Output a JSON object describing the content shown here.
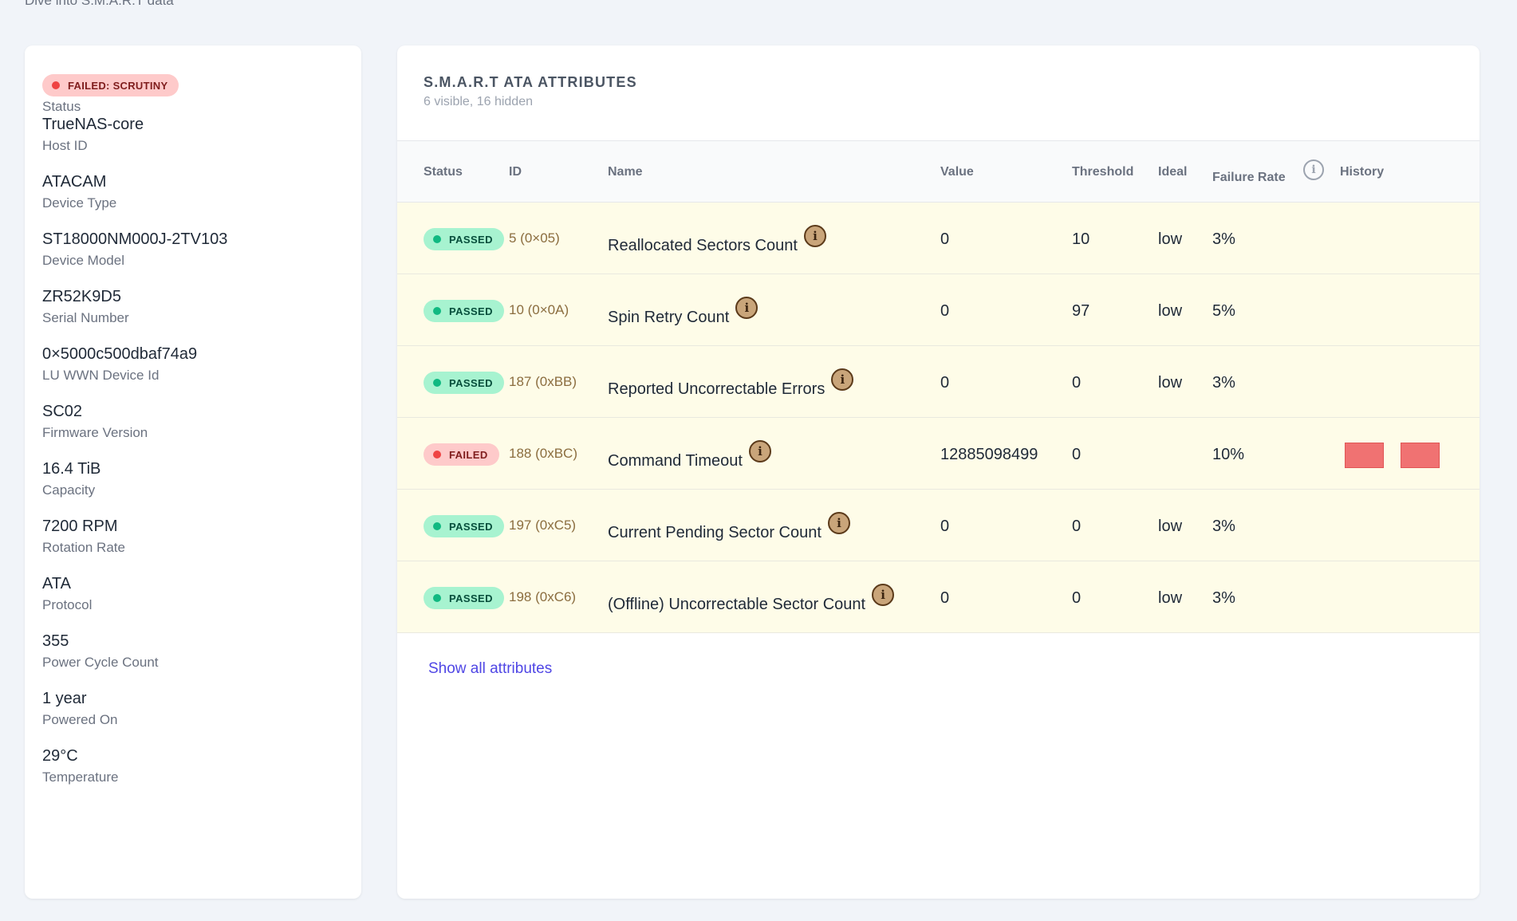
{
  "page": {
    "subtitle": "Dive into S.M.A.R.T data"
  },
  "device": {
    "status_badge": "FAILED: SCRUTINY",
    "status_label": "Status",
    "fields": [
      {
        "value": "TrueNAS-core",
        "label": "Host ID"
      },
      {
        "value": "ATACAM",
        "label": "Device Type"
      },
      {
        "value": "ST18000NM000J-2TV103",
        "label": "Device Model"
      },
      {
        "value": "ZR52K9D5",
        "label": "Serial Number"
      },
      {
        "value": "0×5000c500dbaf74a9",
        "label": "LU WWN Device Id"
      },
      {
        "value": "SC02",
        "label": "Firmware Version"
      },
      {
        "value": "16.4 TiB",
        "label": "Capacity"
      },
      {
        "value": "7200 RPM",
        "label": "Rotation Rate"
      },
      {
        "value": "ATA",
        "label": "Protocol"
      },
      {
        "value": "355",
        "label": "Power Cycle Count"
      },
      {
        "value": "1 year",
        "label": "Powered On"
      },
      {
        "value": "29°C",
        "label": "Temperature"
      }
    ]
  },
  "attributes": {
    "title": "S.M.A.R.T ATA ATTRIBUTES",
    "subtitle": "6 visible, 16 hidden",
    "columns": {
      "status": "Status",
      "id": "ID",
      "name": "Name",
      "value": "Value",
      "threshold": "Threshold",
      "ideal": "Ideal",
      "failure_rate": "Failure Rate",
      "history": "History"
    },
    "rows": [
      {
        "status": "PASSED",
        "id": "5 (0×05)",
        "name": "Reallocated Sectors Count",
        "value": "0",
        "threshold": "10",
        "ideal": "low",
        "failure_rate": "3%",
        "history": 0
      },
      {
        "status": "PASSED",
        "id": "10 (0×0A)",
        "name": "Spin Retry Count",
        "value": "0",
        "threshold": "97",
        "ideal": "low",
        "failure_rate": "5%",
        "history": 0
      },
      {
        "status": "PASSED",
        "id": "187 (0xBB)",
        "name": "Reported Uncorrectable Errors",
        "value": "0",
        "threshold": "0",
        "ideal": "low",
        "failure_rate": "3%",
        "history": 0
      },
      {
        "status": "FAILED",
        "id": "188 (0xBC)",
        "name": "Command Timeout",
        "value": "12885098499",
        "threshold": "0",
        "ideal": "",
        "failure_rate": "10%",
        "history": 2
      },
      {
        "status": "PASSED",
        "id": "197 (0xC5)",
        "name": "Current Pending Sector Count",
        "value": "0",
        "threshold": "0",
        "ideal": "low",
        "failure_rate": "3%",
        "history": 0
      },
      {
        "status": "PASSED",
        "id": "198 (0xC6)",
        "name": "(Offline) Uncorrectable Sector Count",
        "value": "0",
        "threshold": "0",
        "ideal": "low",
        "failure_rate": "3%",
        "history": 0
      }
    ],
    "show_all_link": "Show all attributes"
  },
  "icons": {
    "info": "info-icon"
  },
  "colors": {
    "passed": "#a7f3d0",
    "failed": "#fecaca",
    "row_highlight": "#fefce8",
    "link": "#4f46e5"
  }
}
